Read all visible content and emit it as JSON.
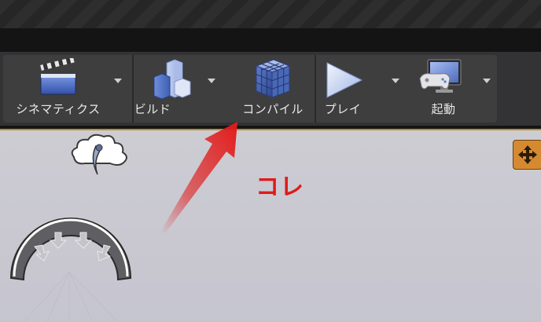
{
  "toolbar": {
    "buttons": [
      {
        "label": "シネマティクス",
        "icon": "clapperboard-icon",
        "has_dropdown": true
      },
      {
        "label": "ビルド",
        "icon": "build-blocks-icon",
        "has_dropdown": true
      },
      {
        "label": "コンパイル",
        "icon": "compile-cube-icon",
        "has_dropdown": false
      },
      {
        "label": "プレイ",
        "icon": "play-icon",
        "has_dropdown": true
      },
      {
        "label": "起動",
        "icon": "launch-monitor-icon",
        "has_dropdown": true
      }
    ]
  },
  "annotation": {
    "text": "コレ",
    "color": "#e01b1b"
  },
  "viewport": {
    "icons": [
      "sky-light-icon",
      "directional-light-icon",
      "move-gizmo-icon"
    ]
  },
  "colors": {
    "accent_gold": "#b8912f",
    "arrow_red": "#e02020"
  }
}
